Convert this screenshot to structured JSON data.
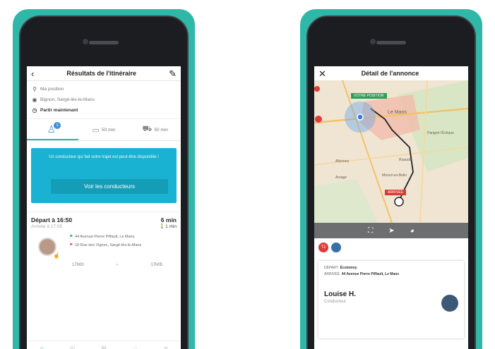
{
  "left": {
    "nav": {
      "back_icon": "‹",
      "title": "Résultats de l'itinéraire",
      "edit_icon": "✎"
    },
    "stops": [
      {
        "icon": "⚲",
        "label": "Ma position",
        "bold": false
      },
      {
        "icon": "◉",
        "label": "Bignon, Sargé-lès-le-Mans",
        "bold": false
      },
      {
        "icon": "◷",
        "label": "Partir maintenant",
        "bold": true
      }
    ],
    "tabs": [
      {
        "icon": "♙",
        "label": "",
        "badge": "1"
      },
      {
        "icon": "▭",
        "label": "50 min"
      },
      {
        "icon": "⛟",
        "label": "50 min"
      }
    ],
    "promo": {
      "text": "Un conducteur qui fait votre trajet est peut-être disponible !",
      "button": "Voir les conducteurs"
    },
    "trip": {
      "departure": "Départ à 16:50",
      "arrival": "Arrivée à 17:05",
      "duration": "6 min",
      "walk": "1 min",
      "from": "44 Avenue Pierre Piffault, Le Mans",
      "to": "18 Rue des Vignes, Sargé-lès-le-Mans",
      "price_left": "17h00",
      "price_mid": "›",
      "price_right": "17h05"
    },
    "tabbar": [
      "⌂",
      "◎",
      "⊞",
      "♢",
      "≡"
    ]
  },
  "right": {
    "nav": {
      "close_icon": "✕",
      "title": "Détail de l'annonce"
    },
    "map": {
      "flag_start": "VOTRE POSITION",
      "flag_end": "ARRIVÉE",
      "labels": [
        "Le Mans",
        "Allonnes",
        "Parigné-l'Évêque",
        "Ruaudin",
        "Moncé-en-Belin",
        "Arnage"
      ]
    },
    "toolbar": [
      "⛶",
      "➤",
      "◕"
    ],
    "chips": [
      {
        "label": "T1",
        "color": "red"
      },
      {
        "label": "",
        "color": "blue"
      }
    ],
    "detail": {
      "depart_label": "DÉPART",
      "depart_value": "Écommoy",
      "arrivee_label": "ARRIVÉE",
      "arrivee_value": "44 Avenue Pierre Piffault, Le Mans",
      "driver_name": "Louise H.",
      "driver_role": "Conducteur"
    }
  }
}
